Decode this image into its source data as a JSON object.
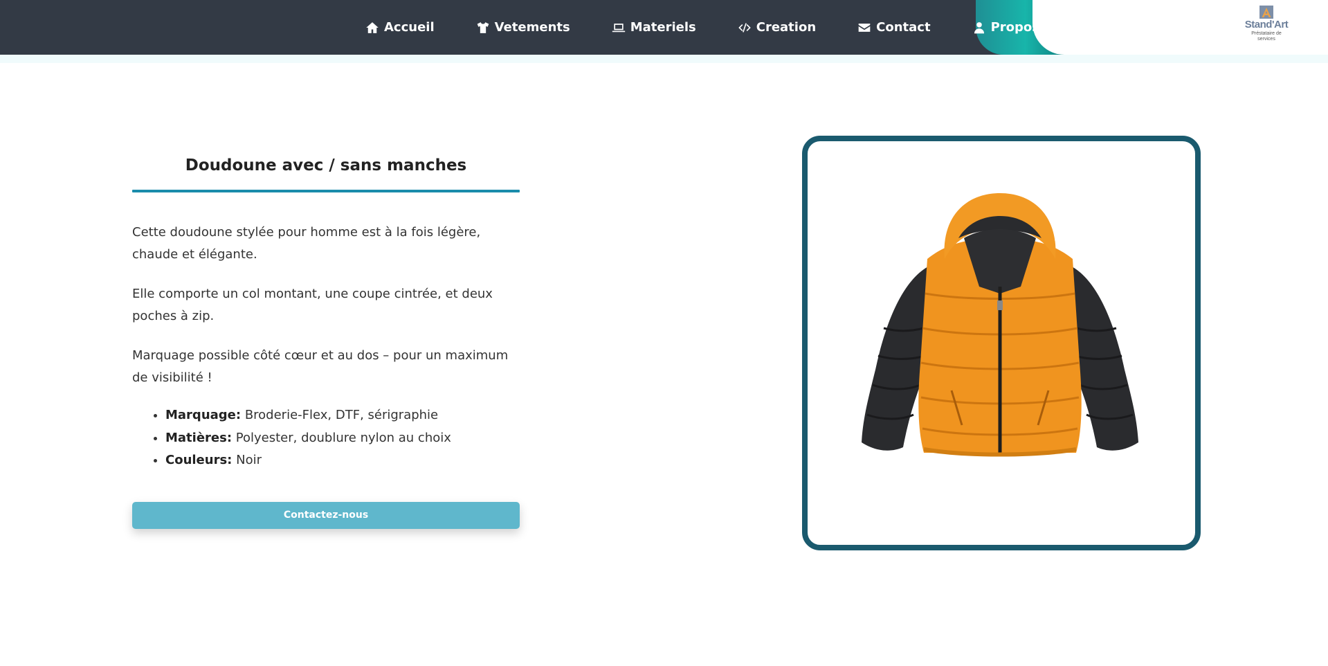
{
  "colors": {
    "header_bg": "#333a45",
    "accent_teal": "#1a8cab",
    "frame_border": "#1a5a6e",
    "button_bg": "#5fb7cc"
  },
  "nav": {
    "items": [
      {
        "label": "Accueil",
        "icon": "home-icon"
      },
      {
        "label": "Vetements",
        "icon": "tshirt-icon"
      },
      {
        "label": "Materiels",
        "icon": "laptop-icon"
      },
      {
        "label": "Creation",
        "icon": "code-icon"
      },
      {
        "label": "Contact",
        "icon": "envelope-icon"
      },
      {
        "label": "Propos",
        "icon": "user-icon"
      }
    ]
  },
  "logo": {
    "name": "Stand'Art",
    "subtitle": "Préstataire de services"
  },
  "product": {
    "title": "Doudoune avec / sans manches",
    "paragraphs": [
      "Cette doudoune stylée pour homme est à la fois légère, chaude et élégante.",
      "Elle comporte un col montant, une coupe cintrée, et deux poches à zip.",
      "Marquage possible côté cœur et au dos – pour un maximum de visibilité !"
    ],
    "specs": [
      {
        "key": "Marquage:",
        "value": "Broderie-Flex, DTF, sérigraphie"
      },
      {
        "key": "Matières:",
        "value": "Polyester, doublure nylon au choix"
      },
      {
        "key": "Couleurs:",
        "value": "Noir"
      }
    ],
    "cta_label": "Contactez-nous",
    "image": "orange-black-puffer-jacket"
  }
}
